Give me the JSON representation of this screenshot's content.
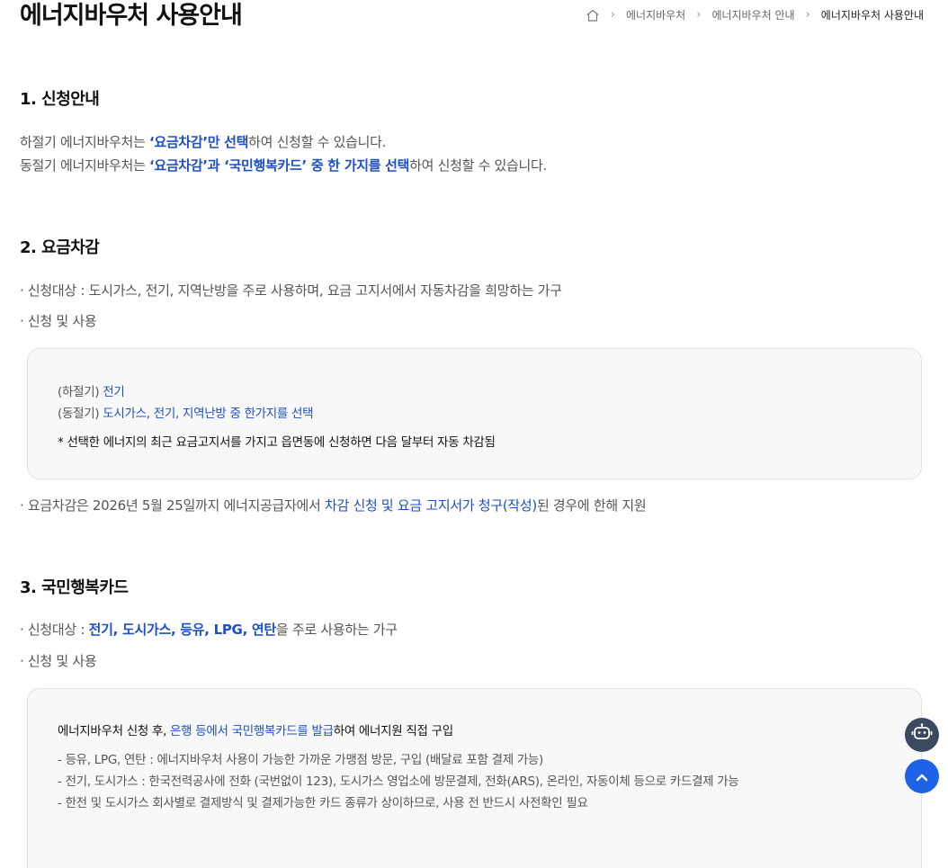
{
  "header": {
    "title": "에너지바우처 사용안내",
    "breadcrumb": [
      "에너지바우처",
      "에너지바우처 안내",
      "에너지바우처 사용안내"
    ]
  },
  "section1": {
    "title": "1. 신청안내",
    "line1": {
      "a": "하절기 에너지바우처는 ",
      "b": "‘요금차감’만 선택",
      "c": "하여 신청할 수 있습니다."
    },
    "line2": {
      "a": "동절기 에너지바우처는 ",
      "b": "‘요금차감’과 ‘국민행복카드’ 중 한 가지를 선택",
      "c": "하여 신청할 수 있습니다."
    }
  },
  "section2": {
    "title": "2. 요금차감",
    "target": "· 신청대상 : 도시가스, 전기, 지역난방을 주로 사용하며, 요금 고지서에서 자동차감을 희망하는 가구",
    "apply": "· 신청 및 사용",
    "box": {
      "summer_label": "(하절기) ",
      "summer_value": "전기",
      "winter_label": "(동절기) ",
      "winter_value": "도시가스, 전기, 지역난방 중 한가지를 선택",
      "note": "* 선택한 에너지의 최근 요금고지서를 가지고 읍면동에 신청하면 다음 달부터 자동 차감됨"
    },
    "deadline": {
      "a": "· 요금차감은 2026년 5월 25일까지 에너지공급자에서 ",
      "b": "차감 신청 및 요금 고지서가 청구(작성)",
      "c": "된 경우에 한해 지원"
    }
  },
  "section3": {
    "title": "3. 국민행복카드",
    "target": {
      "a": "· 신청대상 : ",
      "b": "전기, 도시가스, 등유, LPG, 연탄",
      "c": "을 주로 사용하는 가구"
    },
    "apply": "· 신청 및 사용",
    "box": {
      "intro": {
        "a": "에너지바우처 신청 후, ",
        "b": "은행 등에서 국민행복카드를 발급",
        "c": "하여 에너지원 직접 구입"
      },
      "items": [
        "- 등유, LPG, 연탄 : 에너지바우처 사용이 가능한 가까운 가맹점 방문, 구입 (배달료 포함 결제 가능)",
        "- 전기, 도시가스 : 한국전력공사에 전화 (국번없이 123), 도시가스 영업소에 방문결제, 전화(ARS), 온라인, 자동이체 등으로 카드결제 가능",
        "- 한전 및 도시가스 회사별로 결제방식 및 결제가능한 카드 종류가 상이하므로, 사용 전 반드시 사전확인 필요"
      ]
    }
  },
  "icons": {
    "home": "home-icon",
    "chatbot": "robot-icon",
    "scroll_top": "chevron-up-icon"
  },
  "colors": {
    "accent": "#1c4fc9",
    "top_button": "#1e62e8",
    "bot_button": "#3b4a5e"
  }
}
